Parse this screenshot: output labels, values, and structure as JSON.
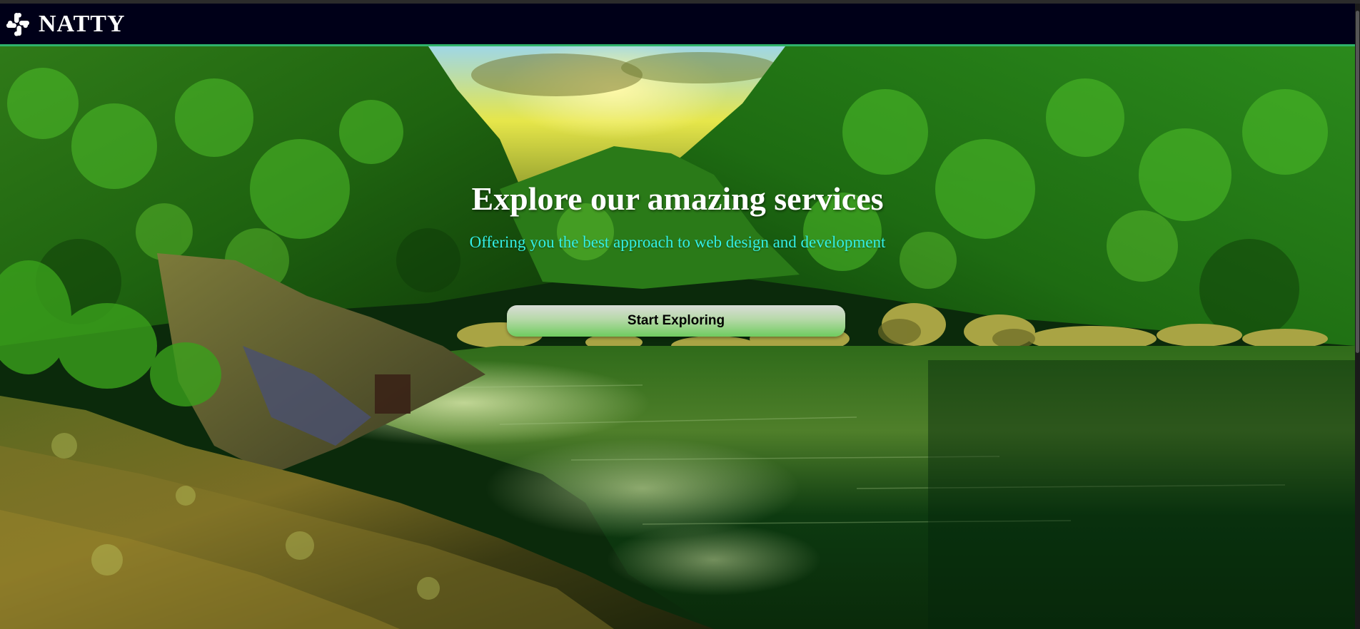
{
  "header": {
    "logo_icon": "slack-hash-icon",
    "brand": "NATTY",
    "background_color": "#000018",
    "border_color": "#2fb36b"
  },
  "hero": {
    "title": "Explore our amazing services",
    "subtitle": "Offering you the best approach to web design and development",
    "cta_label": "Start Exploring",
    "title_color": "#ffffff",
    "subtitle_color": "#33f0e6",
    "background_image": "forest-river-landscape"
  }
}
